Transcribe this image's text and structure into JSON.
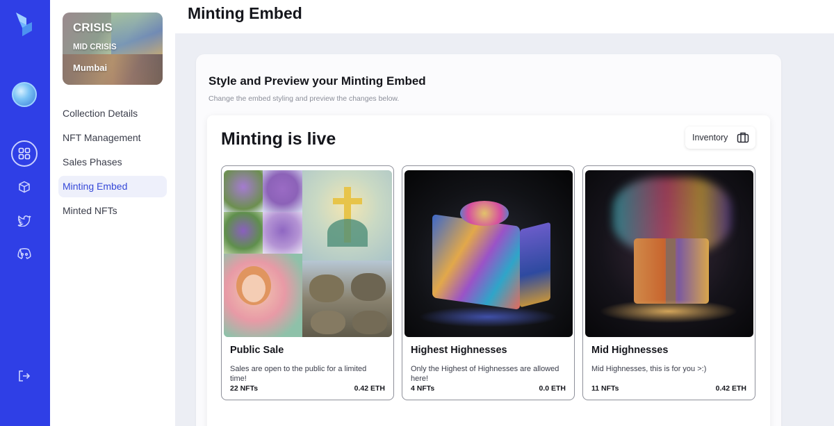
{
  "rail": {
    "icons": [
      "logo-icon",
      "avatar-globe",
      "dashboard-grid-icon",
      "cube-icon",
      "twitter-icon",
      "discord-icon",
      "logout-icon"
    ]
  },
  "collection": {
    "title": "CRISIS",
    "subtitle": "MID CRISIS",
    "location": "Mumbai"
  },
  "sidebar": {
    "items": [
      {
        "label": "Collection Details",
        "active": false
      },
      {
        "label": "NFT Management",
        "active": false
      },
      {
        "label": "Sales Phases",
        "active": false
      },
      {
        "label": "Minting Embed",
        "active": true
      },
      {
        "label": "Minted NFTs",
        "active": false
      }
    ]
  },
  "header": {
    "title": "Minting Embed"
  },
  "panel": {
    "title": "Style and Preview your Minting Embed",
    "subtitle": "Change the embed styling and preview the changes below."
  },
  "embed": {
    "title": "Minting is live",
    "inventory_label": "Inventory",
    "cards": [
      {
        "name": "Public Sale",
        "description": "Sales are open to the public for a limited time!",
        "count": "22 NFTs",
        "price": "0.42 ETH"
      },
      {
        "name": "Highest Highnesses",
        "description": "Only the Highest of Highnesses are allowed here!",
        "count": "4 NFTs",
        "price": "0.0 ETH"
      },
      {
        "name": "Mid Highnesses",
        "description": "Mid Highnesses, this is for you >:)",
        "count": "11 NFTs",
        "price": "0.42 ETH"
      }
    ]
  },
  "colors": {
    "rail": "#2f3fe6",
    "active_text": "#3548d8",
    "active_bg": "#eef0fb"
  }
}
